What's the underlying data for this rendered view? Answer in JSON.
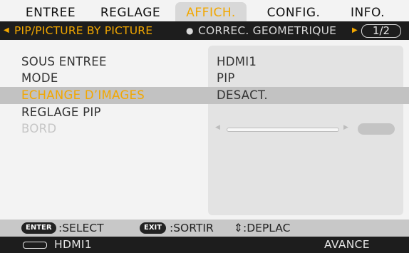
{
  "tabs": [
    "ENTREE",
    "REGLAGE",
    "AFFICH.",
    "CONFIG.",
    "INFO."
  ],
  "active_tab": "AFFICH.",
  "subbar": {
    "current": "PIP/PICTURE BY PICTURE",
    "next": "CORREC. GEOMETRIQUE",
    "page": "1/2"
  },
  "menu": [
    {
      "label": "SOUS ENTREE",
      "value": "HDMI1"
    },
    {
      "label": "MODE",
      "value": "PIP"
    },
    {
      "label": "ECHANGE D’IMAGES",
      "value": "DESACT."
    },
    {
      "label": "REGLAGE PIP",
      "value": ""
    },
    {
      "label": "BORD",
      "value": ""
    }
  ],
  "selected_item": "ECHANGE D’IMAGES",
  "disabled_item": "BORD",
  "help": [
    {
      "key": "ENTER",
      "text": ":SELECT"
    },
    {
      "key": "EXIT",
      "text": ":SORTIR"
    },
    {
      "key": "",
      "text": "⇕:DEPLAC"
    }
  ],
  "status": {
    "source": "HDMI1",
    "level": "AVANCE"
  },
  "colors": {
    "accent": "#f2a700",
    "selected_row": "#c2c2c2",
    "dark_bar": "#1d1d1d",
    "panel": "#e3e3e3"
  }
}
